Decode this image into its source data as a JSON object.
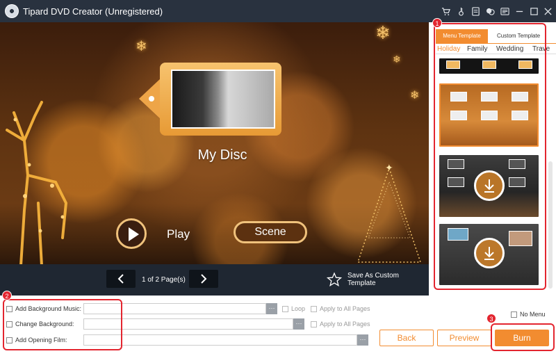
{
  "window": {
    "title": "Tipard DVD Creator (Unregistered)",
    "icons": [
      "cart-icon",
      "key-icon",
      "document-icon",
      "chat-icon",
      "menu-icon",
      "minimize-icon",
      "maximize-icon",
      "close-icon"
    ]
  },
  "preview": {
    "disc_title": "My Disc",
    "play_label": "Play",
    "scene_label": "Scene"
  },
  "pager": {
    "page_text": "1 of 2 Page(s)",
    "save_custom_label": "Save As Custom Template"
  },
  "right_panel": {
    "tabs": [
      "Menu Template",
      "Custom Template"
    ],
    "categories": [
      "Holiday",
      "Family",
      "Wedding",
      "Trave"
    ],
    "arrows": "◀▶"
  },
  "bottom": {
    "options": [
      {
        "label": "Add Background Music:"
      },
      {
        "label": "Change Background:"
      },
      {
        "label": "Add Opening Film:"
      }
    ],
    "loop_label": "Loop",
    "apply_all_label": "Apply to All Pages",
    "browse_label": "···",
    "no_menu_label": "No Menu",
    "buttons": {
      "back": "Back",
      "preview": "Preview",
      "burn": "Burn"
    }
  },
  "annotations": [
    "1",
    "2",
    "3"
  ],
  "colors": {
    "accent": "#f28c30",
    "titlebar": "#29323f",
    "pager_bar": "#1f2732",
    "annotation": "#e3252f"
  }
}
